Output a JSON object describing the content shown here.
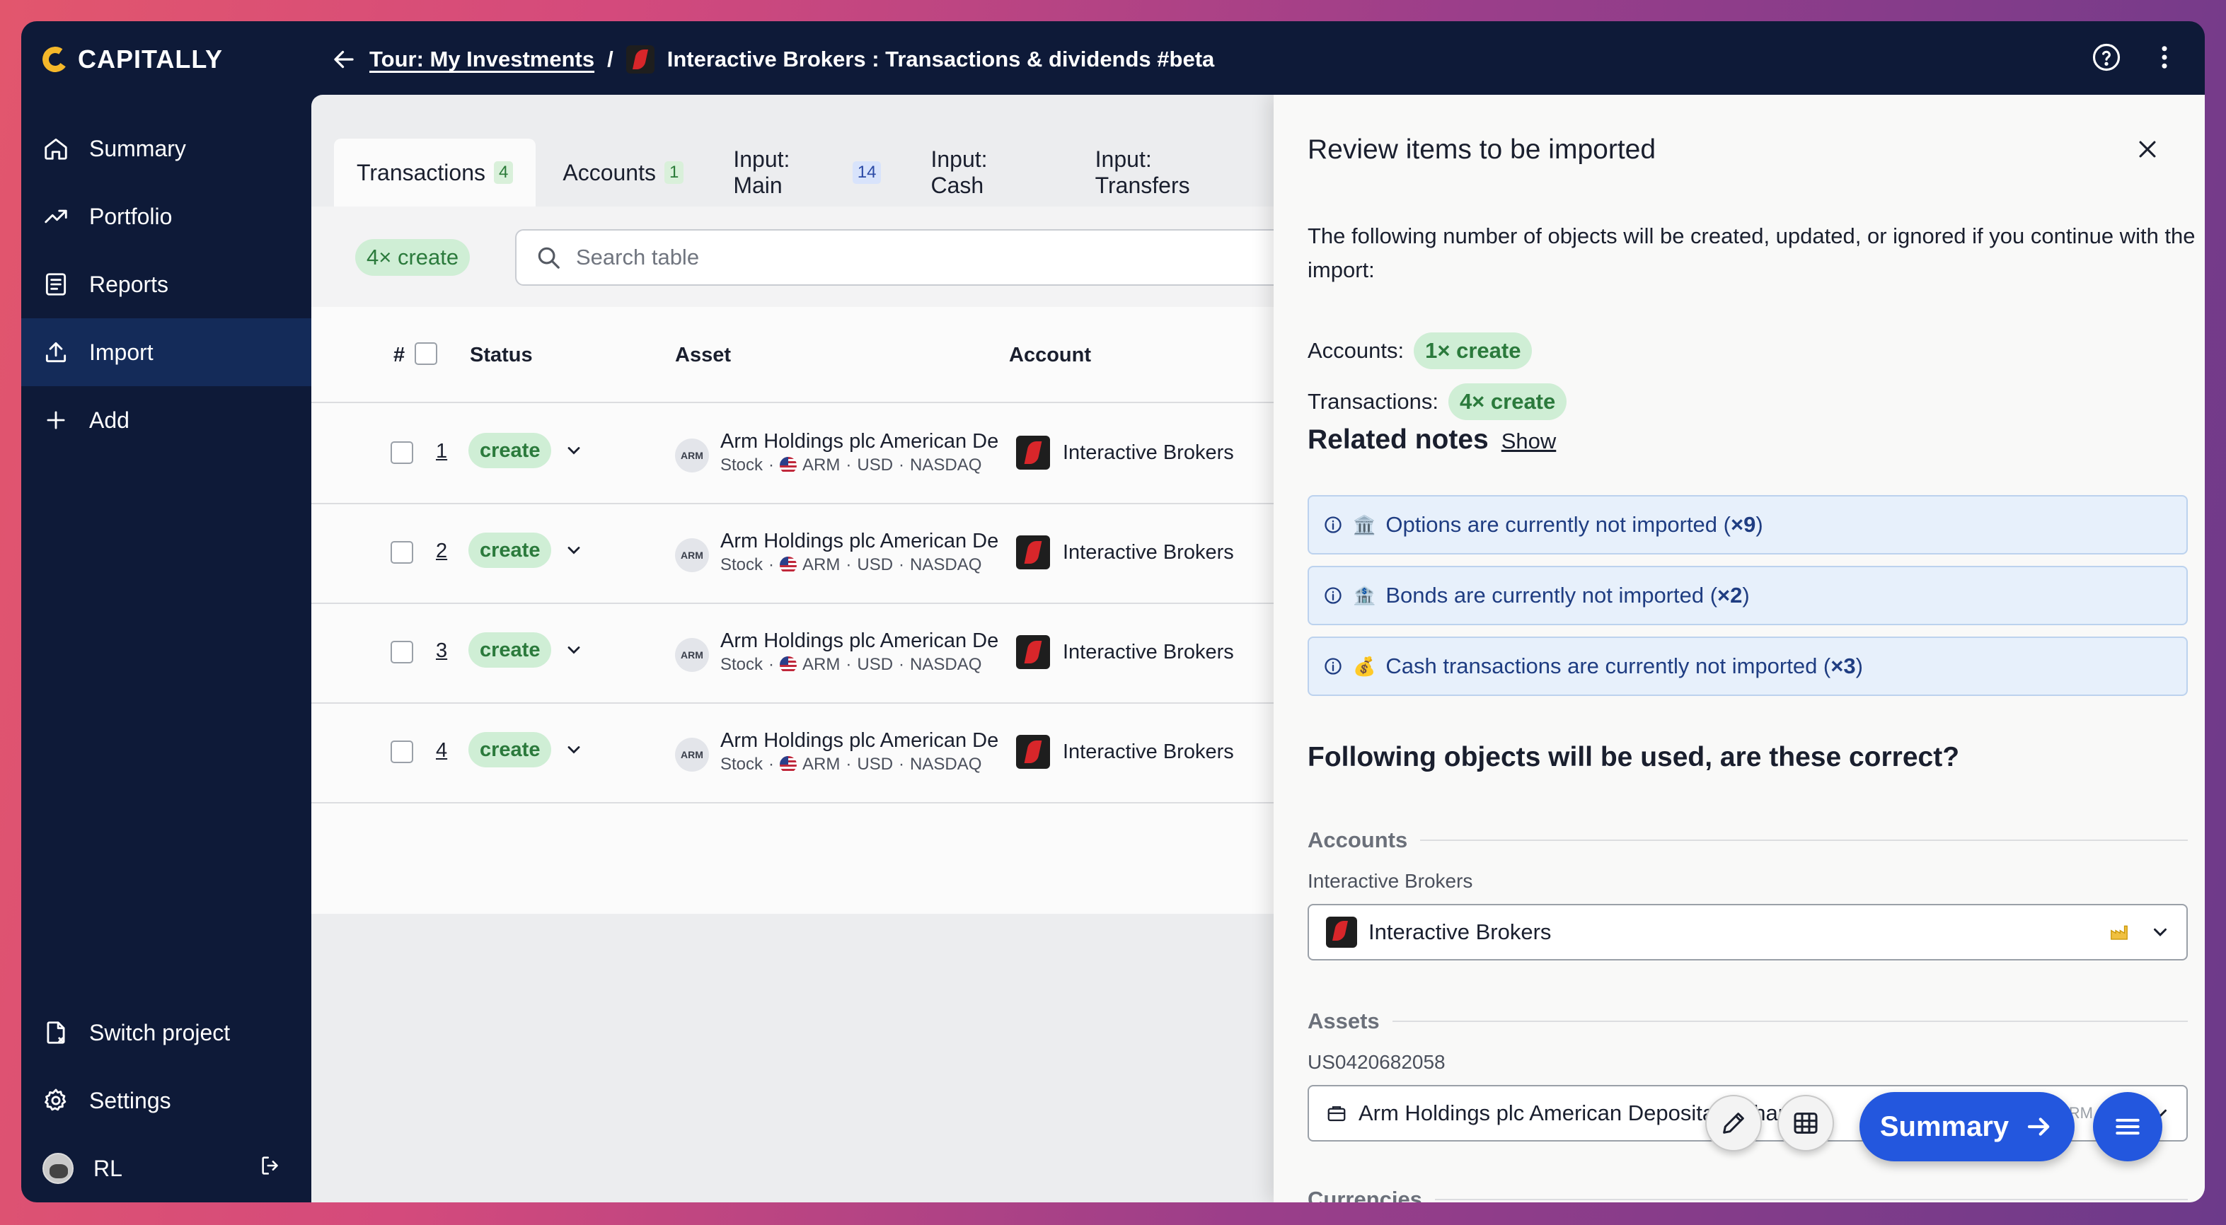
{
  "app": {
    "name": "CAPITALLY"
  },
  "breadcrumb": {
    "parent": "Tour: My Investments",
    "separator": "/",
    "current": "Interactive Brokers : Transactions & dividends #beta"
  },
  "sidebar": {
    "items": [
      {
        "label": "Summary",
        "icon": "home-icon"
      },
      {
        "label": "Portfolio",
        "icon": "trend-icon"
      },
      {
        "label": "Reports",
        "icon": "document-icon"
      },
      {
        "label": "Import",
        "icon": "upload-icon",
        "active": true
      },
      {
        "label": "Add",
        "icon": "plus-icon"
      }
    ],
    "bottom": {
      "switch_project": "Switch project",
      "settings": "Settings",
      "user": "RL"
    }
  },
  "tabs": [
    {
      "label": "Transactions",
      "badge": "4",
      "active": true
    },
    {
      "label": "Accounts",
      "badge": "1"
    },
    {
      "label": "Input: Main",
      "badge": "14"
    },
    {
      "label": "Input: Cash"
    },
    {
      "label": "Input: Transfers"
    }
  ],
  "filter": {
    "chip": "4× create",
    "search_placeholder": "Search table"
  },
  "table": {
    "headers": {
      "num": "#",
      "status": "Status",
      "asset": "Asset",
      "account": "Account"
    },
    "rows": [
      {
        "num": "1",
        "status": "create",
        "asset_logo": "ARM",
        "asset": "Arm Holdings plc American De",
        "asset_type": "Stock",
        "ticker": "ARM",
        "currency": "USD",
        "exchange": "NASDAQ",
        "account": "Interactive Brokers"
      },
      {
        "num": "2",
        "status": "create",
        "asset_logo": "ARM",
        "asset": "Arm Holdings plc American De",
        "asset_type": "Stock",
        "ticker": "ARM",
        "currency": "USD",
        "exchange": "NASDAQ",
        "account": "Interactive Brokers"
      },
      {
        "num": "3",
        "status": "create",
        "asset_logo": "ARM",
        "asset": "Arm Holdings plc American De",
        "asset_type": "Stock",
        "ticker": "ARM",
        "currency": "USD",
        "exchange": "NASDAQ",
        "account": "Interactive Brokers"
      },
      {
        "num": "4",
        "status": "create",
        "asset_logo": "ARM",
        "asset": "Arm Holdings plc American De",
        "asset_type": "Stock",
        "ticker": "ARM",
        "currency": "USD",
        "exchange": "NASDAQ",
        "account": "Interactive Brokers"
      }
    ],
    "sub_separator": "·"
  },
  "drawer": {
    "title": "Review items to be imported",
    "description": "The following number of objects will be created, updated, or ignored if you continue with the import:",
    "counts": [
      {
        "label": "Accounts:",
        "chip": "1× create"
      },
      {
        "label": "Transactions:",
        "chip": "4× create"
      }
    ],
    "related_notes": {
      "title": "Related notes",
      "show": "Show",
      "notes": [
        {
          "emoji": "🏛️",
          "text": "Options are currently not imported (",
          "count": "×9",
          "close": ")"
        },
        {
          "emoji": "🏦",
          "text": "Bonds are currently not imported (",
          "count": "×2",
          "close": ")"
        },
        {
          "emoji": "💰",
          "text": "Cash transactions are currently not imported (",
          "count": "×3",
          "close": ")"
        }
      ]
    },
    "following_title": "Following objects will be used, are these correct?",
    "accounts_section": {
      "title": "Accounts",
      "field_label": "Interactive Brokers",
      "value": "Interactive Brokers"
    },
    "assets_section": {
      "title": "Assets",
      "field_label": "US0420682058",
      "value": "Arm Holdings plc American Depositary Shares",
      "ticker": "ARM"
    },
    "currencies_section": {
      "title": "Currencies"
    }
  },
  "fab": {
    "summary": "Summary"
  },
  "colors": {
    "accent": "#2357de",
    "sidebar_bg": "#0e1a38",
    "chip_bg": "#cfeed5",
    "chip_text": "#2b7a3c",
    "note_bg": "#e7f0fb"
  }
}
